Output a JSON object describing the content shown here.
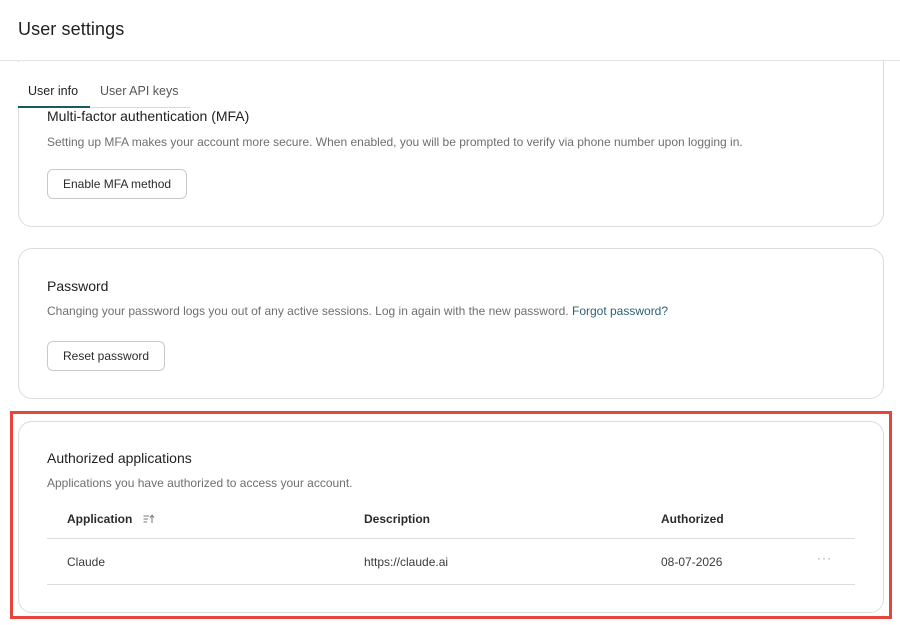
{
  "header": {
    "title": "User settings"
  },
  "tabs": [
    {
      "label": "User info",
      "active": true
    },
    {
      "label": "User API keys",
      "active": false
    }
  ],
  "mfa": {
    "title": "Multi-factor authentication (MFA)",
    "description": "Setting up MFA makes your account more secure. When enabled, you will be prompted to verify via phone number upon logging in.",
    "button_label": "Enable MFA method"
  },
  "password": {
    "title": "Password",
    "description": "Changing your password logs you out of any active sessions. Log in again with the new password.",
    "forgot_link": "Forgot password?",
    "button_label": "Reset password"
  },
  "authorized_apps": {
    "title": "Authorized applications",
    "description": "Applications you have authorized to access your account.",
    "columns": [
      "Application",
      "Description",
      "Authorized"
    ],
    "rows": [
      {
        "application": "Claude",
        "description": "https://claude.ai",
        "authorized": "08-07-2026",
        "actions": "···"
      }
    ]
  },
  "colors": {
    "accent": "#1a5960",
    "link": "#2f6072",
    "highlight": "#e5453a"
  },
  "icons": {
    "sort": "sort-ascending-icon",
    "row_actions": "more-horizontal-icon"
  }
}
